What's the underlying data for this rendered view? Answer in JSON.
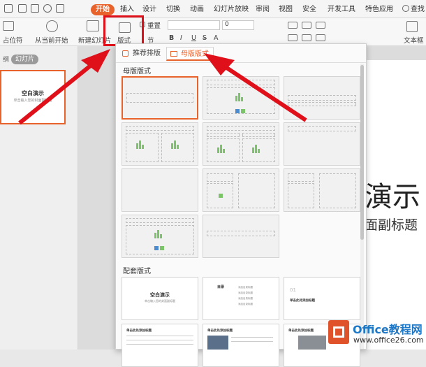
{
  "tabs": [
    "开始",
    "插入",
    "设计",
    "切换",
    "动画",
    "幻灯片放映",
    "审阅",
    "视图",
    "安全",
    "开发工具",
    "特色应用"
  ],
  "search_label": "查找",
  "toolbar": {
    "placeholder_label": "占位符",
    "play_from_current": "从当前开始",
    "new_slide": "新建幻灯片",
    "layout": "版式",
    "reset": "重置",
    "section": "节",
    "font_size": "0",
    "text_box": "文本框",
    "bold": "B",
    "italic": "I",
    "underline": "U",
    "strike": "S",
    "shadow": "A"
  },
  "left_panel": {
    "outline_tab": "纲",
    "slides_tab": "幻灯片",
    "thumb_title": "空白演示",
    "thumb_sub": "单击输入您的封面副标题"
  },
  "slide": {
    "title_part": "演示",
    "subtitle_part": "面副标题"
  },
  "panel": {
    "tab_recommended": "推荐排版",
    "tab_master": "母版版式",
    "section_master": "母版版式",
    "section_matched": "配套版式"
  },
  "matched": [
    {
      "title": "空白演示",
      "sub": "单击输入您的封面副标题"
    },
    {
      "title": "目录",
      "items": [
        "添加目录标题",
        "添加目录标题",
        "添加目录标题",
        "添加目录标题"
      ]
    },
    {
      "num": "01",
      "title": "单击此处添加标题"
    },
    {
      "title": "单击此处添加标题"
    },
    {
      "title": "单击此处添加标题"
    },
    {
      "title": "单击此处添加标题"
    }
  ],
  "watermark": {
    "logo_text": "Office教程网",
    "url": "www.office26.com"
  },
  "colors": {
    "accent": "#e8622c",
    "highlight_box": "#e0101a",
    "arrow": "#e0101a"
  }
}
